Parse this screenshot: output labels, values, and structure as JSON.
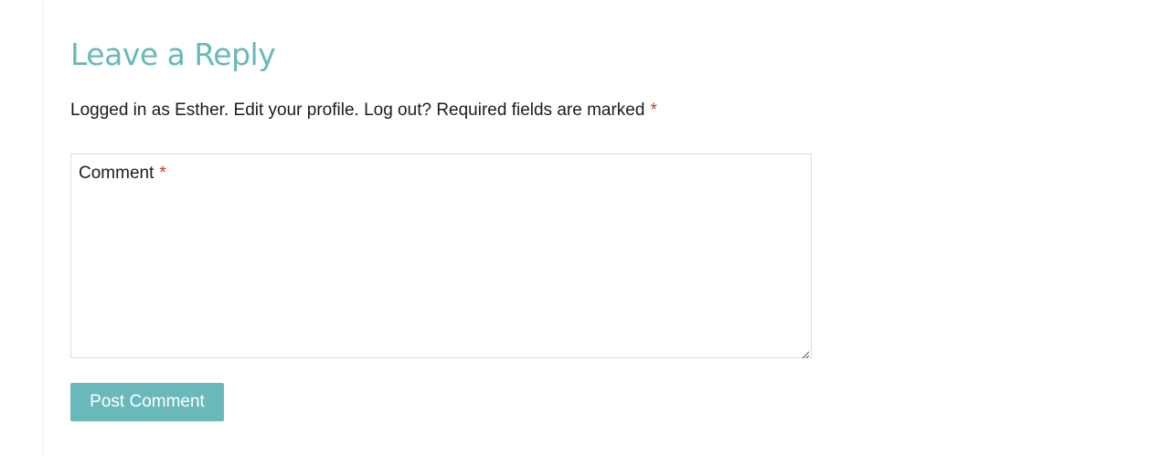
{
  "reply": {
    "title": "Leave a Reply",
    "logged_in_text": "Logged in as Esther. Edit your profile. Log out? Required fields are marked",
    "required_marker": "*",
    "comment_label": "Comment",
    "comment_value": "",
    "submit_label": "Post Comment"
  },
  "colors": {
    "accent": "#69b8ba",
    "required": "#c0392b",
    "text": "#1b1b1b",
    "border": "#dcdcdc"
  },
  "icons": {
    "resize_handle": "resize-handle-icon"
  }
}
